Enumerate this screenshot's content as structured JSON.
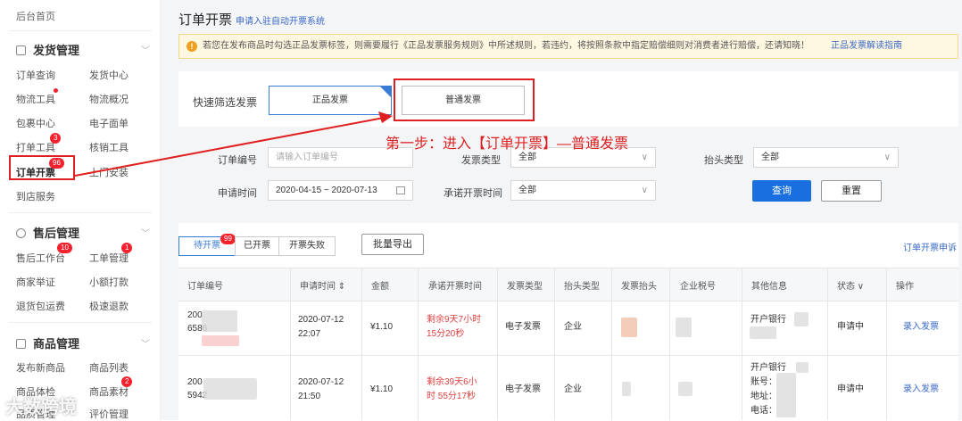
{
  "sidebar": {
    "home": "后台首页",
    "sections": [
      {
        "title": "发货管理",
        "items": [
          "订单查询",
          "发货中心",
          "物流工具",
          "物流概况",
          "包裹中心",
          "电子面单",
          "打单工具",
          "核销工具",
          "订单开票",
          "上门安装",
          "到店服务"
        ]
      },
      {
        "title": "售后管理",
        "items": [
          "售后工作台",
          "工单管理",
          "商家举证",
          "小额打款",
          "退货包运费",
          "极速退款"
        ]
      },
      {
        "title": "商品管理",
        "items": [
          "发布新商品",
          "商品列表",
          "商品体检",
          "商品素材",
          "品质管理",
          "评价管理"
        ]
      }
    ],
    "badges": {
      "dayin": "3",
      "kaipiao": "96",
      "shouhou": "10",
      "gongdan": "1",
      "sucai": "2"
    }
  },
  "header": {
    "title": "订单开票",
    "subtitle": "申请入驻自动开票系统"
  },
  "notice": {
    "text": "若您在发布商品时勾选正品发票标签，则需要履行《正品发票服务规则》中所述规则，若违约，将按照条款中指定赔偿细则对消费者进行赔偿，还请知晓！",
    "link": "正品发票解读指南"
  },
  "quick": {
    "label": "快速筛选发票",
    "opt1": "正品发票",
    "opt2": "普通发票",
    "check": "✓"
  },
  "annotation": "第一步：进入【订单开票】—普通发票",
  "filters": {
    "order_label": "订单编号",
    "order_placeholder": "请输入订单编号",
    "invoice_type_label": "发票类型",
    "invoice_type_value": "全部",
    "head_type_label": "抬头类型",
    "head_type_value": "全部",
    "apply_time_label": "申请时间",
    "apply_time_value": "2020-04-15 ~ 2020-07-13",
    "promise_label": "承诺开票时间",
    "promise_value": "全部",
    "query": "查询",
    "reset": "重置"
  },
  "tabs": {
    "pending": "待开票",
    "pending_count": "99",
    "done": "已开票",
    "failed": "开票失败",
    "export": "批量导出",
    "complaint": "订单开票申诉"
  },
  "table": {
    "headers": [
      "订单编号",
      "申请时间 ⇕",
      "金额",
      "承诺开票时间",
      "发票类型",
      "抬头类型",
      "发票抬头",
      "企业税号",
      "其他信息",
      "状态 ∨",
      "操作"
    ],
    "rows": [
      {
        "order1": "200",
        "order2": "6586",
        "date": "2020-07-12",
        "time": "22:07",
        "amount": "¥1.10",
        "promise1": "剩余9天7小时",
        "promise2": "15分20秒",
        "type": "电子发票",
        "head": "企业",
        "info1": "开户银行",
        "status": "申请中",
        "action": "录入发票"
      },
      {
        "order1": "200",
        "order2": "5942",
        "date": "2020-07-12",
        "time": "21:50",
        "amount": "¥1.10",
        "promise1": "剩余39天6小",
        "promise2": "时 55分17秒",
        "type": "电子发票",
        "head": "企业",
        "info1": "开户银行",
        "info2": "账号：",
        "info3": "地址：",
        "info4": "电话：",
        "status": "申请中",
        "action": "录入发票"
      }
    ]
  },
  "watermark": "大数跨境"
}
